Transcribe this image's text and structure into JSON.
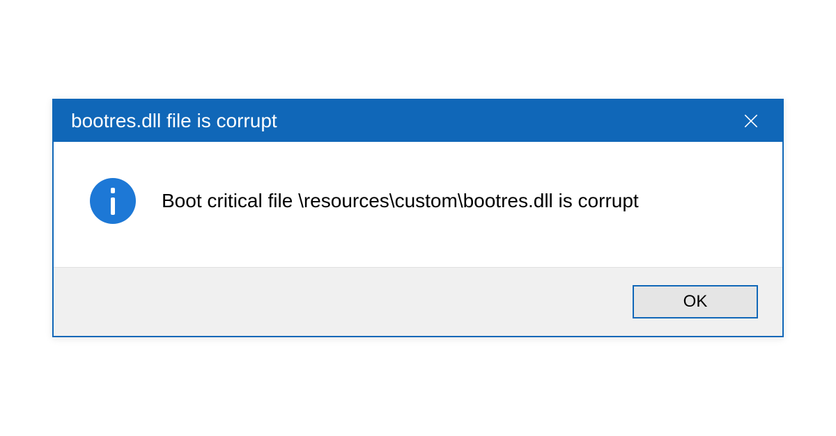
{
  "dialog": {
    "title": "bootres.dll file is corrupt",
    "message": "Boot critical file \\resources\\custom\\bootres.dll is corrupt",
    "ok_label": "OK"
  },
  "colors": {
    "titlebar_bg": "#1067b8",
    "info_icon_bg": "#1d78d6"
  }
}
